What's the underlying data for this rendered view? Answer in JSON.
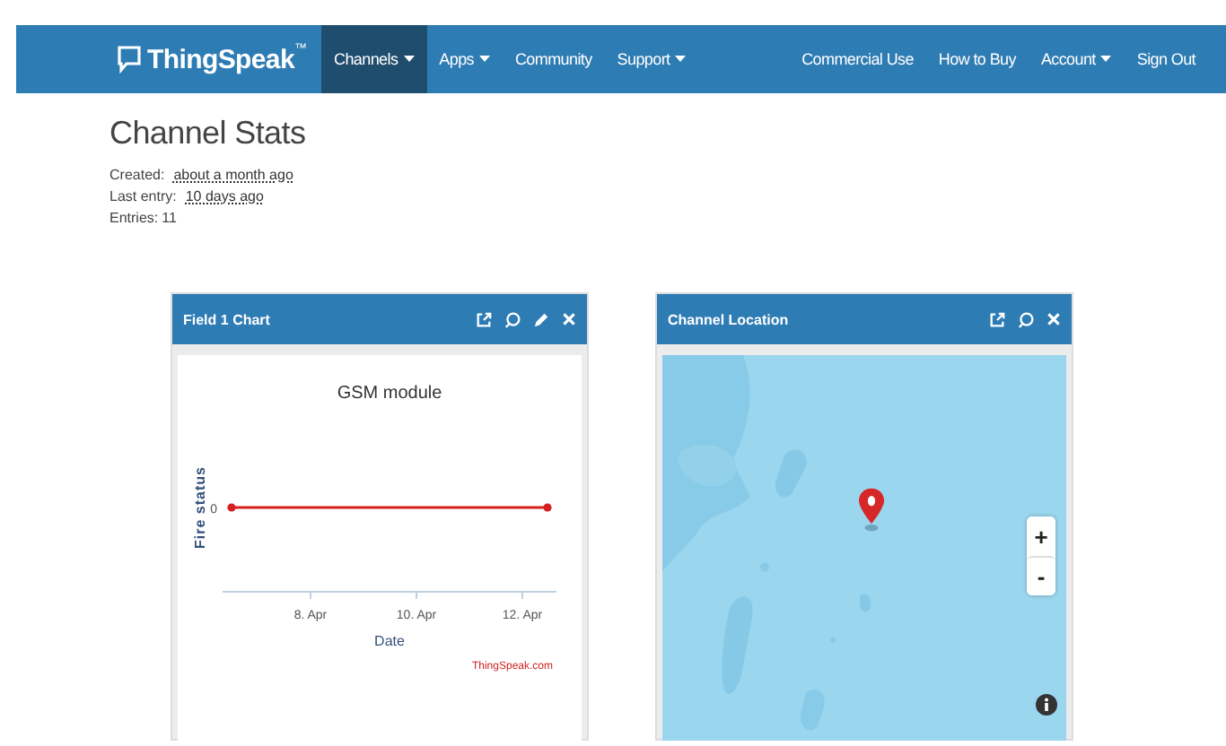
{
  "navbar": {
    "logo": "ThingSpeak",
    "trademark": "™",
    "items": [
      {
        "label": "Channels",
        "dropdown": true,
        "selected": true
      },
      {
        "label": "Apps",
        "dropdown": true,
        "selected": false
      },
      {
        "label": "Community",
        "dropdown": false,
        "selected": false
      },
      {
        "label": "Support",
        "dropdown": true,
        "selected": false
      }
    ],
    "right_items": [
      {
        "label": "Commercial Use",
        "dropdown": false
      },
      {
        "label": "How to Buy",
        "dropdown": false
      },
      {
        "label": "Account",
        "dropdown": true
      },
      {
        "label": "Sign Out",
        "dropdown": false
      }
    ]
  },
  "stats": {
    "title": "Channel Stats",
    "rows": [
      {
        "label": "Created:",
        "value": "about a month ago",
        "link": true
      },
      {
        "label": "Last entry:",
        "value": "10 days ago",
        "link": true
      },
      {
        "label": "Entries:",
        "value": "11",
        "link": false
      }
    ]
  },
  "widgets": [
    {
      "kind": "chart",
      "title": "Field 1 Chart",
      "editable": true,
      "chart": {
        "title": "GSM module",
        "xlabel": "Date",
        "ylabel": "Fire status",
        "x_tick_labels": [
          "8. Apr",
          "10. Apr",
          "12. Apr"
        ],
        "y_tick_label": "0"
      },
      "credit": "ThingSpeak.com"
    },
    {
      "kind": "map",
      "title": "Channel Location",
      "editable": false,
      "zoom_in": "+",
      "zoom_out": "-"
    }
  ]
}
